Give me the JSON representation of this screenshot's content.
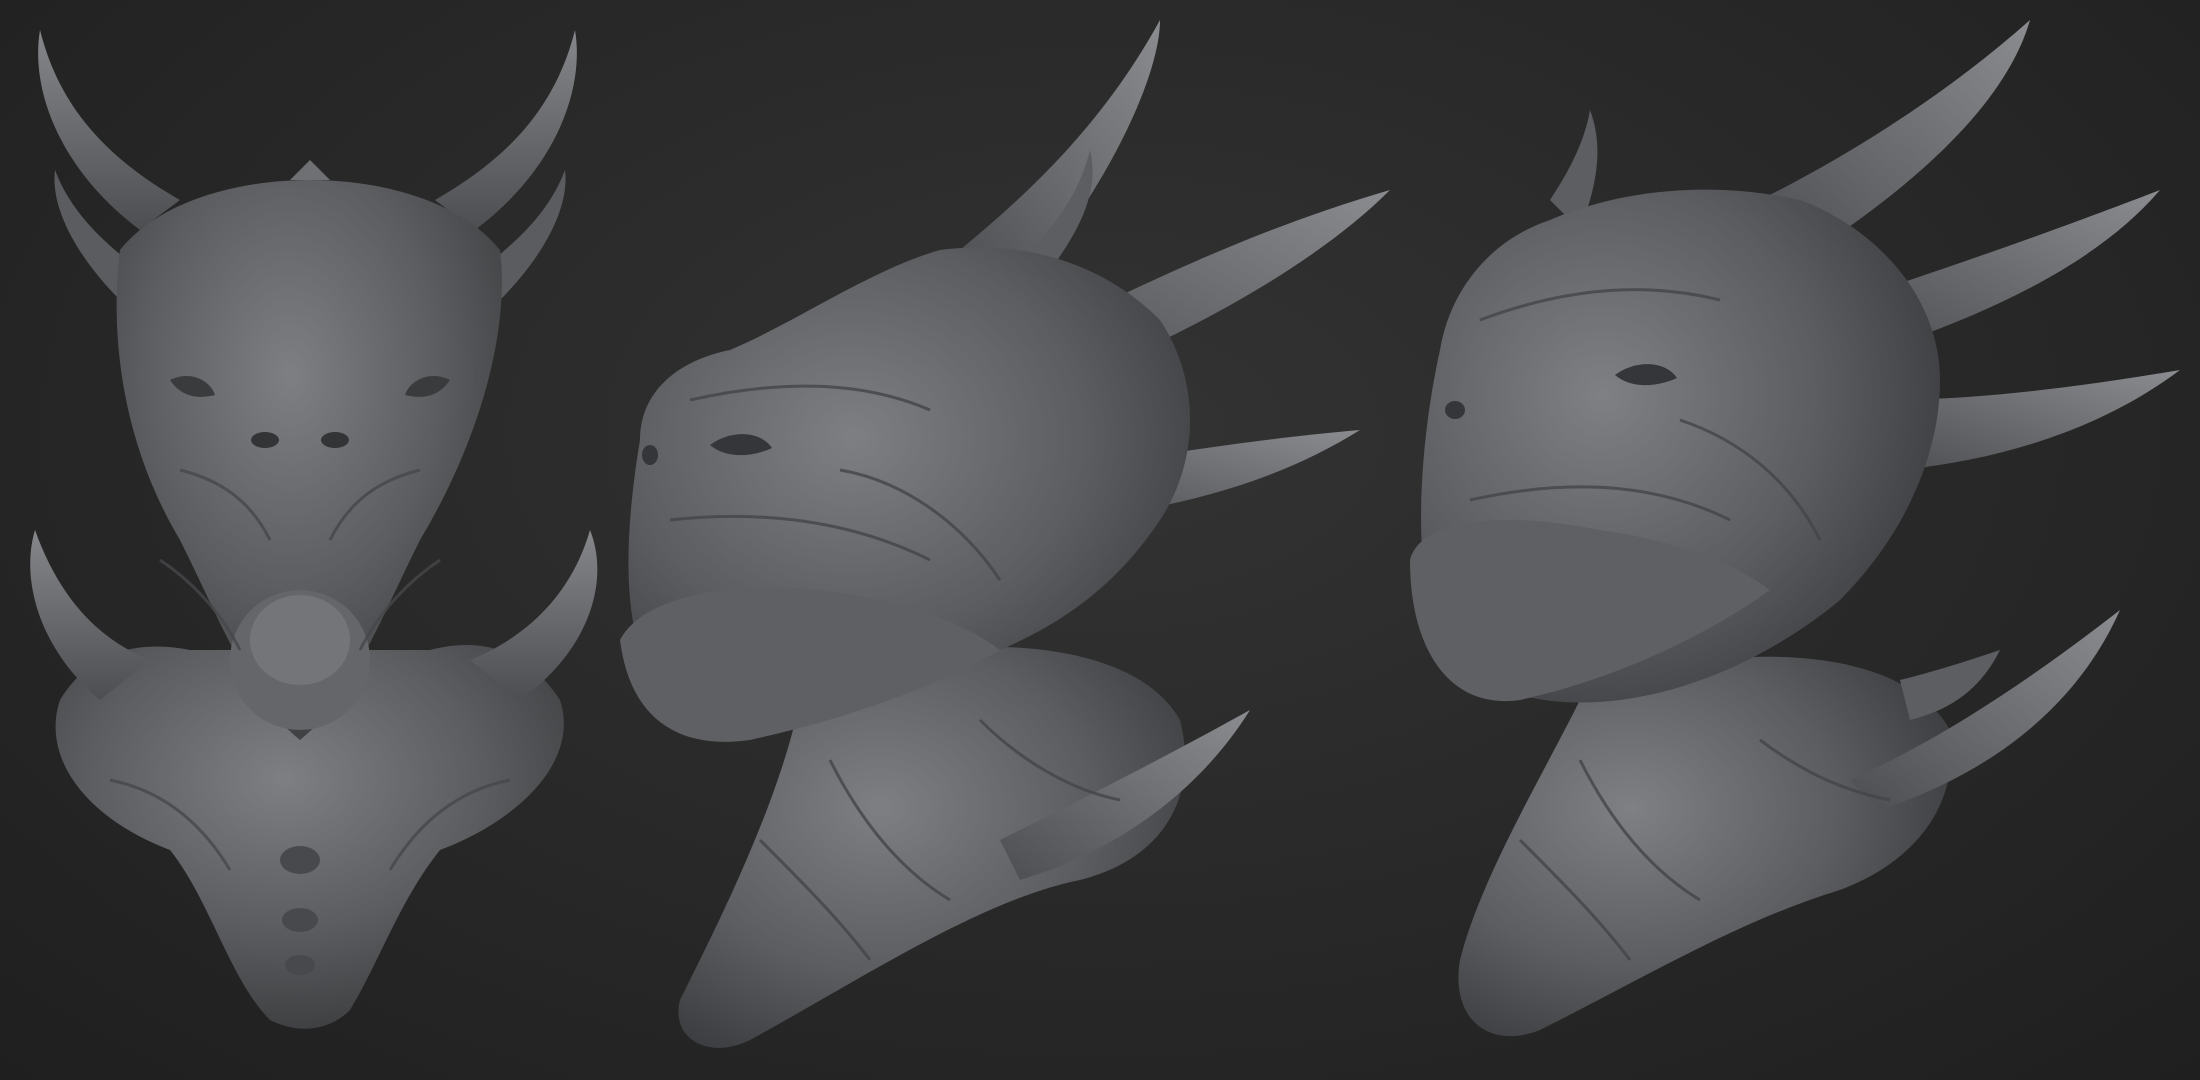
{
  "scene": {
    "background_color": "#262626",
    "sculpt_color": "#5b5d60",
    "sculpt_highlight": "#8a8c90",
    "sculpt_shadow": "#2e2f31",
    "views": [
      {
        "name": "front-view",
        "description_icon": "dragon-head-front"
      },
      {
        "name": "side-view",
        "description_icon": "dragon-head-profile"
      },
      {
        "name": "three-quarter-view",
        "description_icon": "dragon-head-three-quarter"
      }
    ]
  }
}
